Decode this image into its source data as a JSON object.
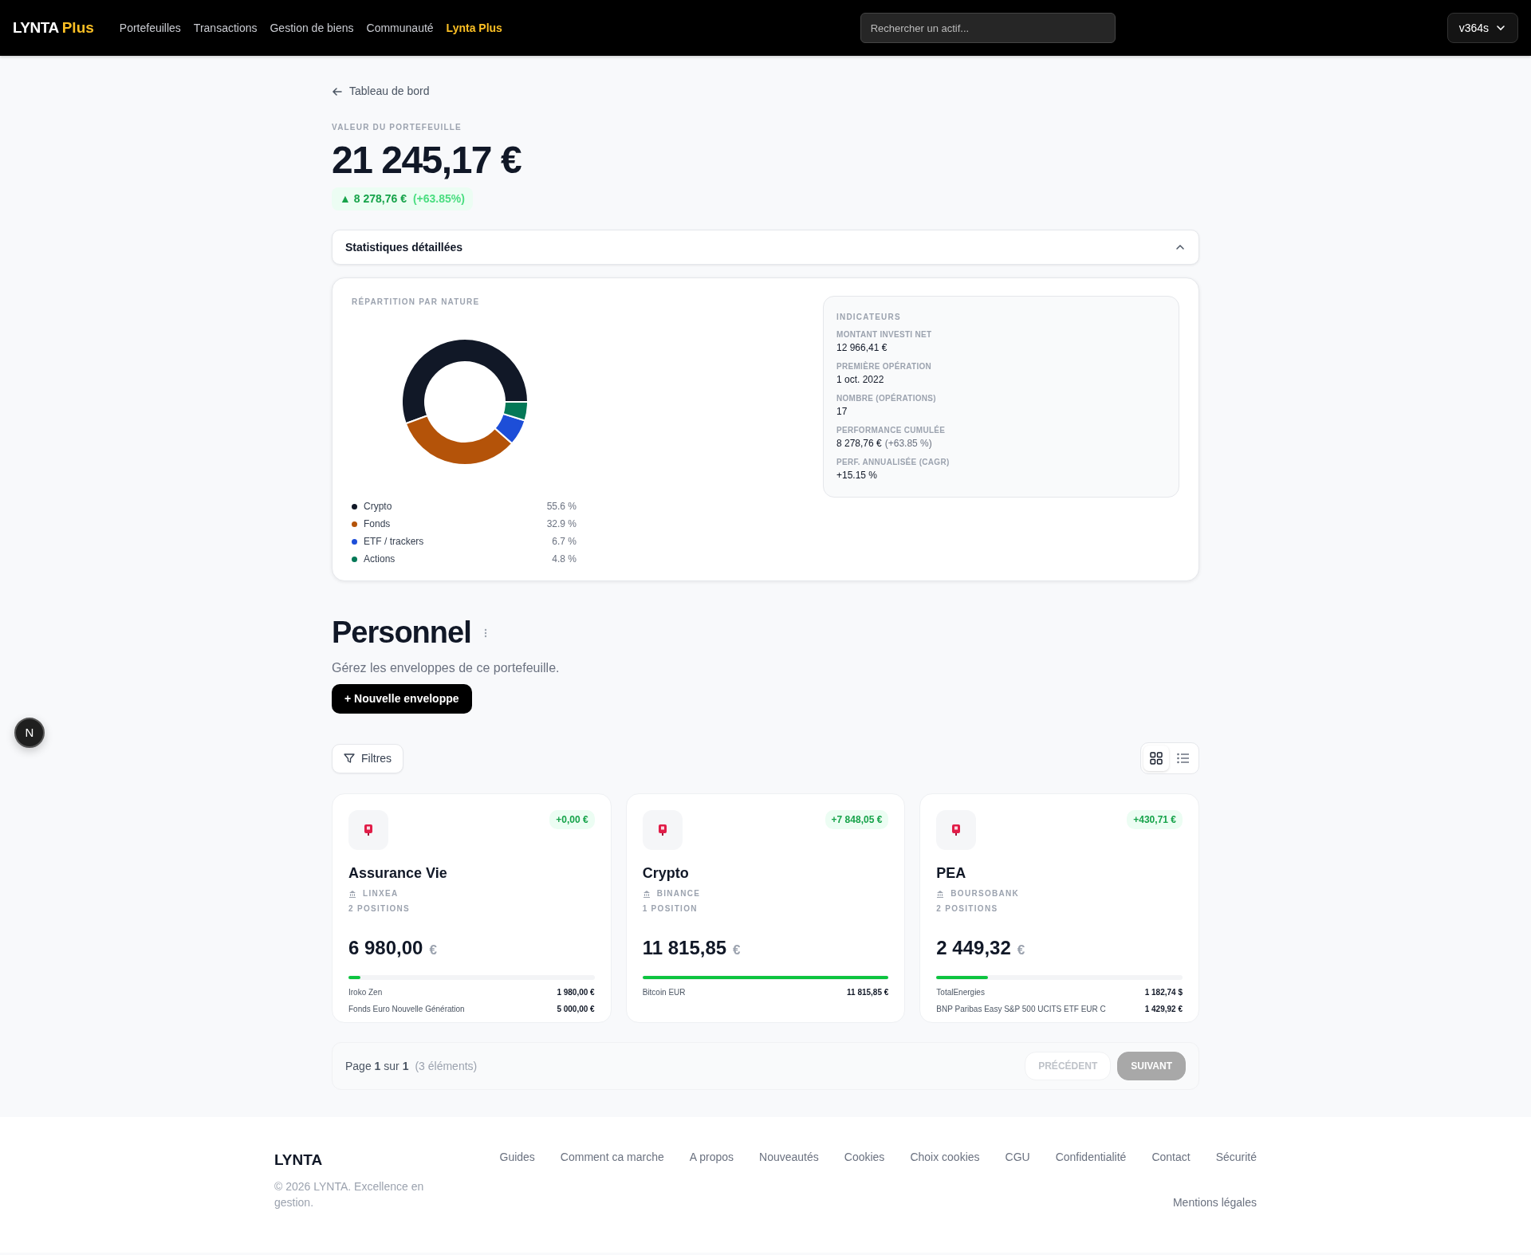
{
  "navbar": {
    "brand": "LYNTA",
    "brand_accent": "Plus",
    "items": [
      {
        "label": "Portefeuilles",
        "selected": false
      },
      {
        "label": "Transactions",
        "selected": false
      },
      {
        "label": "Gestion de biens",
        "selected": false
      },
      {
        "label": "Communauté",
        "selected": false
      },
      {
        "label": "Lynta Plus",
        "selected": true
      }
    ],
    "search": {
      "placeholder": "Rechercher un actif..."
    },
    "user": "v364s"
  },
  "back_link": "Tableau de bord",
  "portfolio": {
    "label": "VALEUR DU PORTEFEUILLE",
    "value": "21 245,17 €",
    "change": "▲ 8 278,76 €",
    "change_pct": "(+63.85%)"
  },
  "stats": {
    "title": "Statistiques détaillées",
    "expanded": true,
    "allocation": {
      "title": "RÉPARTITION PAR NATURE",
      "chart_data": {
        "type": "donut",
        "categories": [
          "Crypto",
          "Fonds",
          "ETF / trackers",
          "Actions"
        ],
        "values": [
          55.6,
          32.9,
          6.7,
          4.8
        ]
      },
      "legend": [
        {
          "value": "55.6 %",
          "color": "#111827"
        },
        {
          "value": "32.9 %",
          "color": "#b45309"
        },
        {
          "value": "6.7 %",
          "color": "#1d4ed8"
        },
        {
          "value": "4.8 %",
          "color": "#047857"
        }
      ]
    },
    "indicators": {
      "title": "INDICATEURS",
      "items": [
        {
          "label": "MONTANT INVESTI NET",
          "value": "12 966,41 €"
        },
        {
          "label": "PREMIÈRE OPÉRATION",
          "value": "1 oct. 2022"
        },
        {
          "label": "NOMBRE (OPÉRATIONS)",
          "value": "17"
        },
        {
          "label": "PERFORMANCE CUMULÉE",
          "value": "8 278,76 €",
          "note": "(+63.85 %)"
        },
        {
          "label": "PERF. ANNUALISÉE (CAGR)",
          "value": "+15.15 %"
        }
      ]
    }
  },
  "section": {
    "title": "Personnel",
    "subtitle": "Gérez les enveloppes de ce portefeuille.",
    "new_button": "+ Nouvelle enveloppe",
    "filters_button": "Filtres",
    "views": [
      {
        "kind": "grid",
        "selected": true
      },
      {
        "kind": "list",
        "selected": false
      }
    ]
  },
  "envelopes": [
    {
      "name": "Assurance Vie",
      "delta": "+0,00 €",
      "broker": "LINXEA",
      "positions": "2 POSITIONS",
      "value": "6 980,00",
      "currency": "€",
      "level": 0.05,
      "holdings": [
        {
          "name": "Iroko Zen",
          "amount": "1 980,00 €"
        },
        {
          "name": "Fonds Euro Nouvelle Génération",
          "amount": "5 000,00 €"
        }
      ]
    },
    {
      "name": "Crypto",
      "delta": "+7 848,05 €",
      "broker": "BINANCE",
      "positions": "1 POSITION",
      "value": "11 815,85",
      "currency": "€",
      "level": 1.0,
      "holdings": [
        {
          "name": "Bitcoin EUR",
          "amount": "11 815,85 €"
        }
      ]
    },
    {
      "name": "PEA",
      "delta": "+430,71 €",
      "broker": "BOURSOBANK",
      "positions": "2 POSITIONS",
      "value": "2 449,32",
      "currency": "€",
      "level": 0.21,
      "holdings": [
        {
          "name": "TotalEnergies",
          "amount": "1 182,74 $"
        },
        {
          "name": "BNP Paribas Easy S&P 500 UCITS ETF EUR C",
          "amount": "1 429,92 €"
        }
      ]
    }
  ],
  "pagination": {
    "text": "Page **1** sur **1**",
    "count": "(3 éléments)",
    "buttons": [
      {
        "label": "PRÉCÉDENT",
        "kind": "secondary",
        "disabled": true
      },
      {
        "label": "SUIVANT",
        "kind": "primary",
        "disabled": true
      }
    ]
  },
  "footer": {
    "brand": "LYNTA",
    "copyright": "© 2026 LYNTA. Excellence en gestion.",
    "links": [
      "Guides",
      "Comment ca marche",
      "A propos",
      "Nouveautés",
      "Cookies",
      "Choix cookies",
      "CGU",
      "Confidentialité",
      "Contact",
      "Sécurité"
    ],
    "legal": "Mentions légales"
  },
  "floating_button": "N"
}
